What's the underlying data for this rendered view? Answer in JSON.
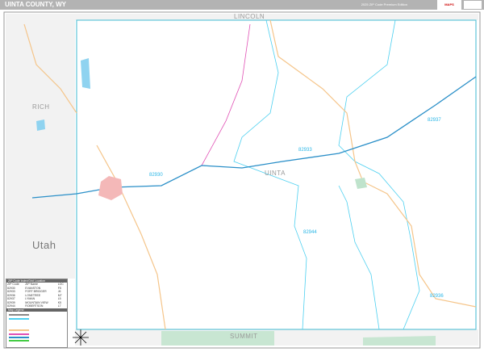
{
  "header": {
    "title": "UINTA COUNTY, WY",
    "edition": "2025 ZIP Code Premium Edition",
    "logo": "MAPS"
  },
  "map": {
    "county_label": "UINTA",
    "neighbors": {
      "north": "LINCOLN",
      "west": "RICH",
      "south": "SUMMIT",
      "state": "Utah"
    },
    "zip_labels": [
      "82930",
      "82933",
      "82937",
      "82944",
      "82936"
    ]
  },
  "legend": {
    "table_title": "ZIP Code Index/Grid Location",
    "columns": [
      "ZIP Code",
      "ZIP Name",
      "LOC"
    ],
    "rows": [
      [
        "82930",
        "EVANSTON",
        "F5"
      ],
      [
        "82933",
        "FORT BRIDGER",
        "J6"
      ],
      [
        "82936",
        "LONETREE",
        "M7"
      ],
      [
        "82937",
        "LYMAN",
        "L5"
      ],
      [
        "82939",
        "MOUNTAIN VIEW",
        "K5"
      ],
      [
        "82944",
        "ROBERTSON",
        "L7"
      ]
    ],
    "key_title": "Map Legend"
  },
  "colors": {
    "header": "#b3b3b3",
    "zip_boundary": "#4dd0f0",
    "interstate": "#2a8fc8",
    "highway": "#f5c58a",
    "city": "#f4b8b8",
    "park": "#bfe3cc"
  }
}
